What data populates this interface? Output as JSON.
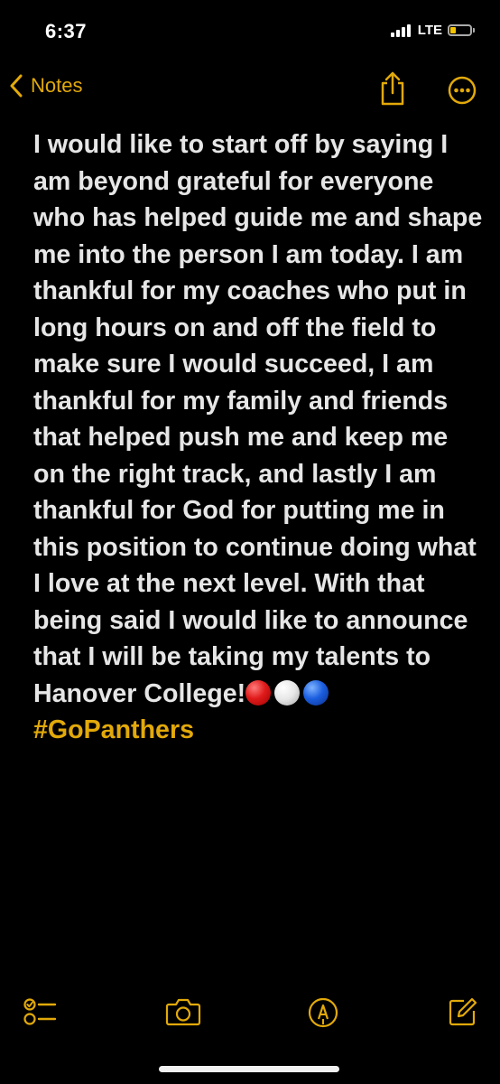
{
  "status_bar": {
    "time": "6:37",
    "network": "LTE",
    "battery_level": 0.3,
    "battery_color": "#f4c400"
  },
  "nav": {
    "back_label": "Notes",
    "back_icon": "chevron-left-icon",
    "share_icon": "share-icon",
    "more_icon": "ellipsis-circle-icon"
  },
  "note": {
    "body_text": "I would like to start off by saying I am beyond grateful for everyone who has helped guide me and shape me into the person I am today. I am thankful for my coaches who put in long hours on and off the field to make sure I would succeed, I am thankful for my family and friends that helped push me and keep me on the right track, and lastly I am thankful for God for putting me in this position to continue doing what I love at the next level. With that being said I would like to announce that I will be taking my talents to Hanover College!",
    "emojis": [
      "red-circle",
      "white-circle",
      "blue-circle"
    ],
    "hashtag": "#GoPanthers"
  },
  "toolbar": {
    "items": [
      "checklist-icon",
      "camera-icon",
      "markup-pen-icon",
      "compose-icon"
    ]
  },
  "colors": {
    "accent": "#e2a90a",
    "background": "#000000",
    "text": "#e6e6e6"
  }
}
